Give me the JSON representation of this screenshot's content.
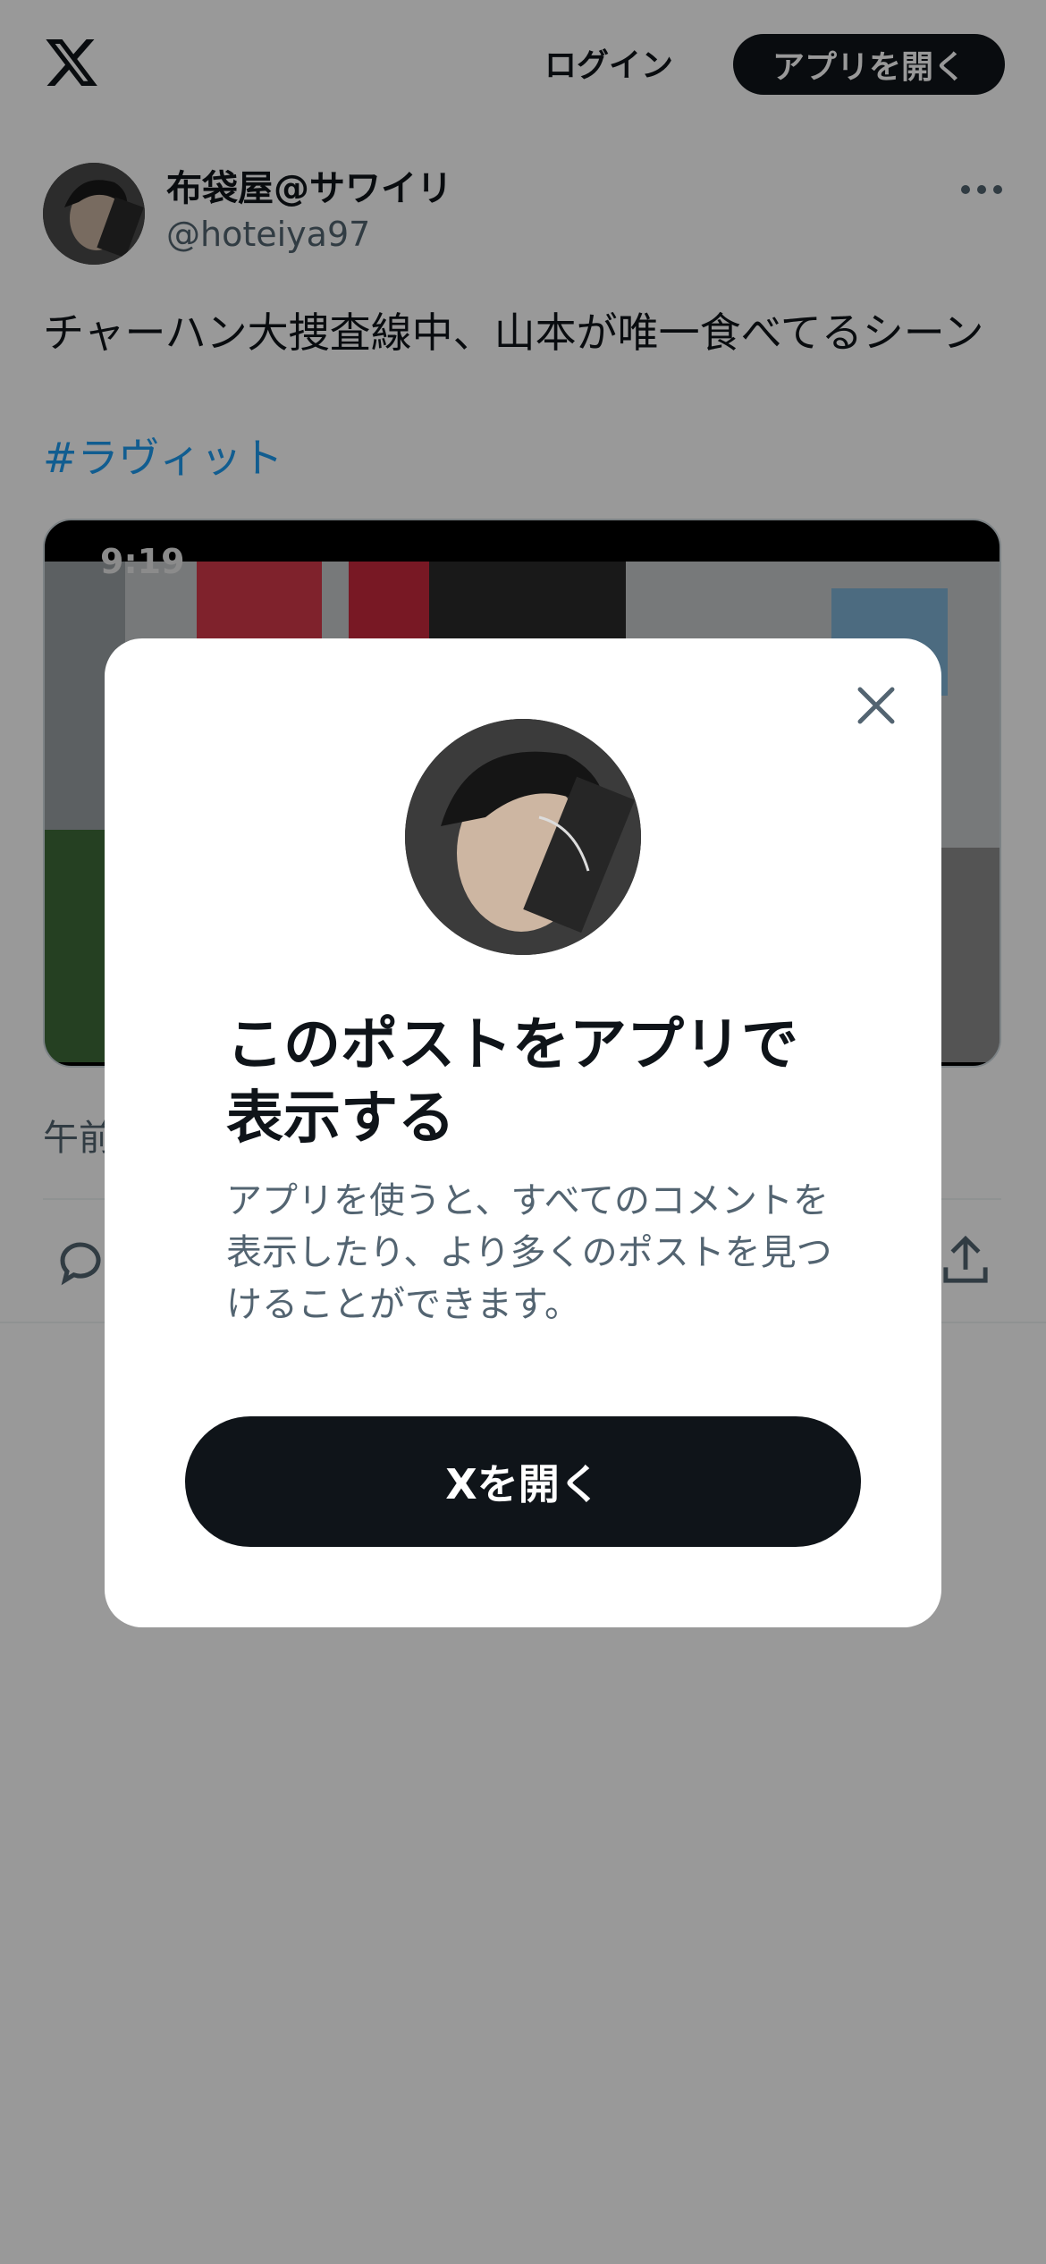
{
  "header": {
    "logo": "x-logo",
    "login_label": "ログイン",
    "open_app_label": "アプリを開く"
  },
  "post": {
    "display_name": "布袋屋@サワイリ",
    "handle": "@hoteiya97",
    "text": "チャーハン大捜査線中、山本が唯一食べてるシーン",
    "hashtag": "#ラヴィット",
    "media": {
      "timecode": "9:19"
    },
    "time_partial": "午前"
  },
  "modal": {
    "title": "このポストをアプリで表示する",
    "subtitle": "アプリを使うと、すべてのコメントを表示したり、より多くのポストを見つけることができます。",
    "button_label": "Xを開く"
  },
  "colors": {
    "text_primary": "#0f1419",
    "text_secondary": "#536471",
    "link": "#1d9bf0",
    "button_dark": "#0f1419"
  }
}
